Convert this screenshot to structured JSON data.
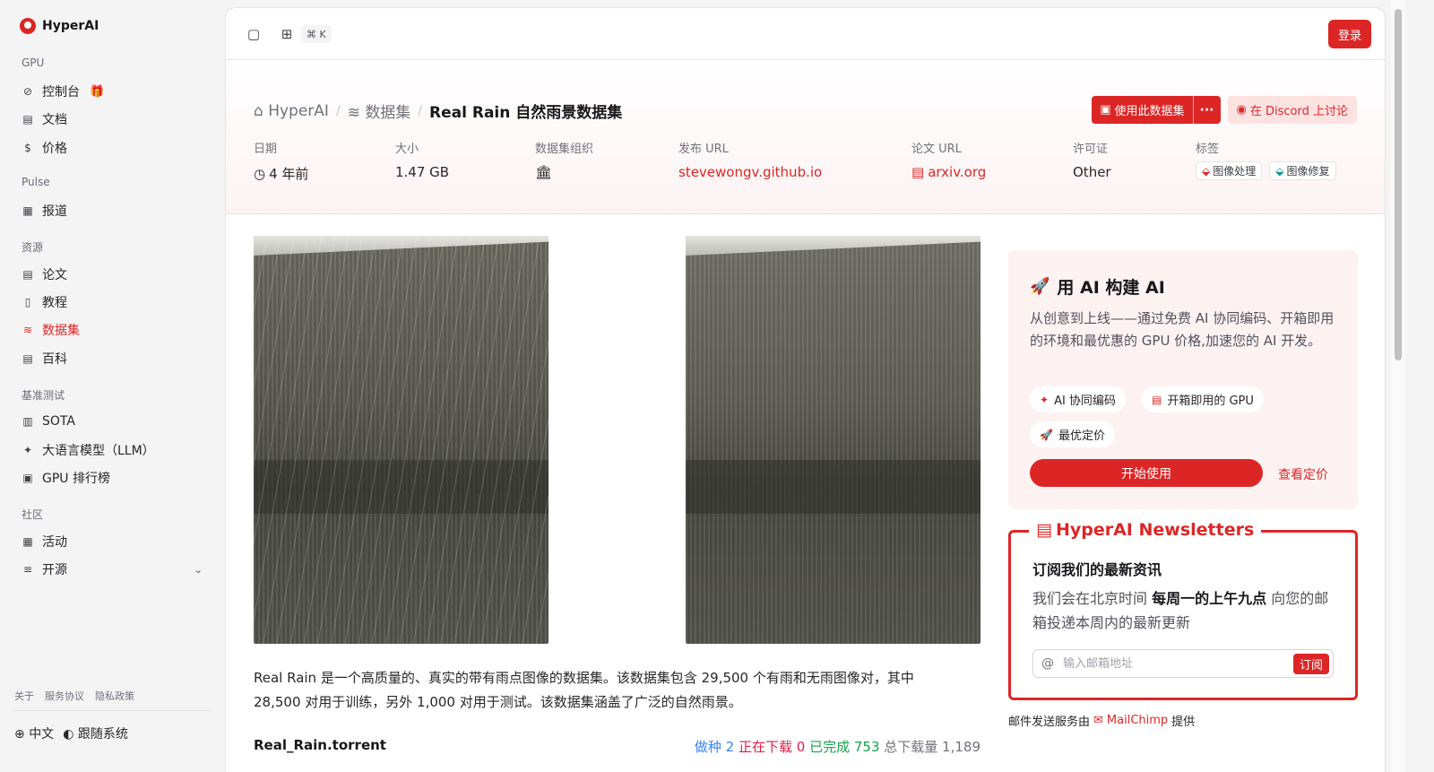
{
  "app": {
    "name": "HyperAI"
  },
  "sidebar": {
    "sections": [
      {
        "title": "GPU"
      },
      {
        "title": "Pulse"
      },
      {
        "title": "资源"
      },
      {
        "title": "基准测试"
      },
      {
        "title": "社区"
      }
    ],
    "items": [
      {
        "label": "控制台",
        "icon": "gauge-icon"
      },
      {
        "label": "文档",
        "icon": "book-icon"
      },
      {
        "label": "价格",
        "icon": "dollar-icon"
      },
      {
        "label": "报道",
        "icon": "newspaper-icon"
      },
      {
        "label": "论文",
        "icon": "paper-icon"
      },
      {
        "label": "教程",
        "icon": "notebook-icon"
      },
      {
        "label": "数据集",
        "icon": "database-icon",
        "active": true
      },
      {
        "label": "百科",
        "icon": "wiki-icon"
      },
      {
        "label": "SOTA",
        "icon": "bar-chart-icon"
      },
      {
        "label": "大语言模型（LLM）",
        "icon": "sparkle-icon"
      },
      {
        "label": "GPU 排行榜",
        "icon": "chip-icon"
      },
      {
        "label": "活动",
        "icon": "calendar-icon"
      },
      {
        "label": "开源",
        "icon": "menu-icon"
      }
    ],
    "footer_links": [
      "关于",
      "服务协议",
      "隐私政策"
    ],
    "language": "中文",
    "theme": "跟随系统"
  },
  "topbar": {
    "shortcut": "⌘ K",
    "login": "登录"
  },
  "breadcrumb": {
    "home": "HyperAI",
    "section": "数据集",
    "current": "Real Rain 自然雨景数据集"
  },
  "actions": {
    "use_dataset": "使用此数据集",
    "more": "···",
    "discord": "在 Discord 上讨论"
  },
  "meta": {
    "date_label": "日期",
    "date_value": "4 年前",
    "size_label": "大小",
    "size_value": "1.47 GB",
    "org_label": "数据集组织",
    "release_label": "发布 URL",
    "release_value": "stevewongv.github.io",
    "paper_label": "论文 URL",
    "paper_value": "arxiv.org",
    "license_label": "许可证",
    "license_value": "Other",
    "tags_label": "标签",
    "tags": [
      "图像处理",
      "图像修复"
    ]
  },
  "description": "Real Rain 是一个高质量的、真实的带有雨点图像的数据集。该数据集包含 29,500 个有雨和无雨图像对，其中 28,500 对用于训练，另外 1,000 对用于测试。该数据集涵盖了广泛的自然雨景。",
  "torrent": {
    "filename": "Real_Rain.torrent",
    "seeding": "做种 2",
    "downloading": "正在下载 0",
    "completed": "已完成 753",
    "total": "总下载量 1,189"
  },
  "ai_card": {
    "title": "用 AI 构建 AI",
    "description": "从创意到上线——通过免费 AI 协同编码、开箱即用的环境和最优惠的 GPU 价格,加速您的 AI 开发。",
    "chips": [
      "AI 协同编码",
      "开箱即用的 GPU",
      "最优定价"
    ],
    "start": "开始使用",
    "pricing": "查看定价"
  },
  "newsletter": {
    "title": "HyperAI Newsletters",
    "heading": "订阅我们的最新资讯",
    "text_before": "我们会在北京时间 ",
    "text_bold": "每周一的上午九点",
    "text_after": " 向您的邮箱投递本周内的最新更新",
    "email_placeholder": "输入邮箱地址",
    "subscribe": "订阅",
    "provider_before": "邮件发送服务由",
    "provider_name": "MailChimp",
    "provider_after": "提供"
  },
  "colors": {
    "accent": "#dc2626",
    "seeding": "#3b82f6",
    "downloading": "#e11d48",
    "completed": "#16a34a"
  }
}
